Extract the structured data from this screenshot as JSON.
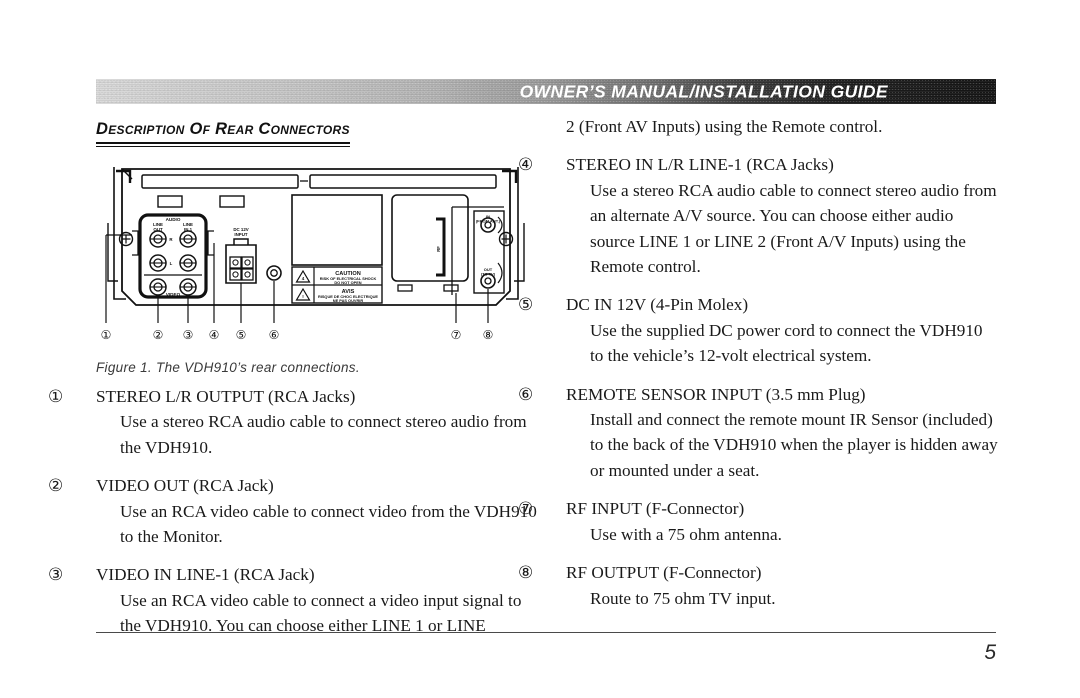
{
  "banner": {
    "title": "OWNER’S MANUAL/INSTALLATION GUIDE"
  },
  "section": {
    "heading": "Description Of Rear Connectors"
  },
  "figure": {
    "caption": "Figure 1. The VDH910’s rear connections.",
    "callouts": [
      "①",
      "②",
      "③",
      "④",
      "⑤",
      "⑥",
      "⑦",
      "⑧"
    ],
    "panel_labels": {
      "audio": "AUDIO",
      "line_out": "LINE\nOUT",
      "line_in_1": "LINE\nIN 1",
      "channel_r": "R",
      "channel_l": "L",
      "video": "VIDEO",
      "dc_input": "DC 12V\nINPUT",
      "rf": "RF",
      "rf_in": "IN\n(FROM ANT.)",
      "rf_out": "OUT\n(TO TV)"
    },
    "caution_label": {
      "en_title": "CAUTION",
      "en_line1": "RISK OF ELECTRICAL SHOCK",
      "en_line2": "DO NOT OPEN",
      "fr_title": "AVIS",
      "fr_line1": "RISQUE DE CHOC ELECTRIQUE",
      "fr_line2": "NE PAS OUVRIR"
    }
  },
  "left_column": {
    "entries": [
      {
        "num": "①",
        "title": "STEREO L/R OUTPUT (RCA Jacks)",
        "body": "Use a stereo RCA audio cable to connect stereo audio from the VDH910."
      },
      {
        "num": "②",
        "title": "VIDEO OUT (RCA Jack)",
        "body": "Use an RCA video cable to connect video from the VDH910 to the Monitor."
      },
      {
        "num": "③",
        "title": "VIDEO IN LINE-1 (RCA Jack)",
        "body": "Use an RCA video cable to connect a video input signal to the VDH910.  You can choose either LINE 1 or LINE"
      }
    ]
  },
  "right_column": {
    "continuation": "2 (Front AV Inputs) using the Remote control.",
    "entries": [
      {
        "num": "④",
        "title": "STEREO IN L/R LINE-1 (RCA Jacks)",
        "body": "Use a stereo RCA audio cable to connect stereo audio from an alternate A/V source.  You can choose either audio source LINE 1 or LINE 2 (Front A/V Inputs) using the Remote control."
      },
      {
        "num": "⑤",
        "title": "DC IN 12V (4-Pin Molex)",
        "body": "Use the supplied DC power cord to connect the VDH910 to the vehicle’s 12-volt electrical system."
      },
      {
        "num": "⑥",
        "title": "REMOTE SENSOR INPUT (3.5 mm Plug)",
        "body": "Install and connect the remote mount IR Sensor (included) to the back of the VDH910 when the player is hidden away or mounted under a seat."
      },
      {
        "num": "⑦",
        "title": "RF INPUT (F-Connector)",
        "body": "Use with a 75 ohm antenna."
      },
      {
        "num": "⑧",
        "title": "RF OUTPUT (F-Connector)",
        "body": "Route to 75 ohm TV input."
      }
    ]
  },
  "footer": {
    "page_number": "5"
  }
}
